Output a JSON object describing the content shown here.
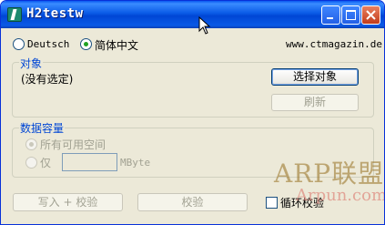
{
  "window": {
    "title": "H2testw",
    "buttons": [
      "minimize",
      "maximize",
      "close"
    ]
  },
  "language": {
    "options": [
      {
        "label": "Deutsch",
        "selected": false
      },
      {
        "label": "简体中文",
        "selected": true
      }
    ],
    "website": "www.ctmagazin.de"
  },
  "target_group": {
    "title": "对象",
    "status": "(没有选定)",
    "select_button": "选择对象",
    "refresh_button": "刷新"
  },
  "capacity_group": {
    "title": "数据容量",
    "all_space_label": "所有可用空间",
    "only_label": "仅",
    "mbyte_value": "",
    "unit": "MByte"
  },
  "actions": {
    "write_verify_button": "写入 + 校验",
    "verify_button": "校验",
    "loop_verify_label": "循环校验"
  },
  "watermark": {
    "line1": "ARP联盟",
    "line2": "Arpun.com"
  },
  "colors": {
    "titlebar": "#0a5ae6",
    "group_title": "#0046d5",
    "window_bg": "#ece9d8",
    "close_button": "#c23c1b"
  }
}
